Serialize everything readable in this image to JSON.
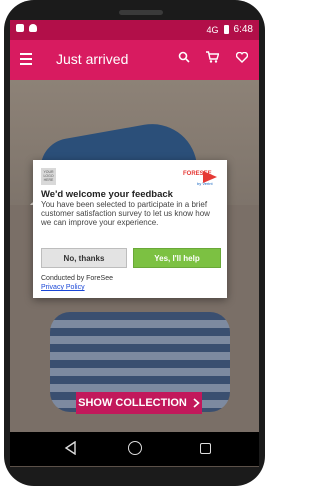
{
  "status_bar": {
    "time": "6:48",
    "signal_text": "4G"
  },
  "app_bar": {
    "title": "Just arrived",
    "colors": {
      "primary": "#d81b60",
      "status": "#b20f49"
    }
  },
  "dialog": {
    "logo_text": "YOUR LOGO HERE",
    "brand": "FORESEE",
    "brand_sub": "by Verint",
    "title": "We'd welcome your feedback",
    "body": "You have been selected to participate in a brief customer satisfaction survey to let us know how we can improve your experience.",
    "no_button": "No, thanks",
    "yes_button": "Yes, I'll help",
    "conducted_by": "Conducted by ForeSee",
    "privacy_link": "Privacy Policy",
    "colors": {
      "yes": "#7cc142",
      "link": "#1a47d6"
    }
  },
  "collection_button": {
    "label": "SHOW COLLECTION",
    "icon": "chevron-right-icon"
  },
  "icons": [
    "menu-icon",
    "search-icon",
    "cart-icon",
    "heart-icon",
    "back-icon",
    "home-icon",
    "recent-apps-icon"
  ]
}
